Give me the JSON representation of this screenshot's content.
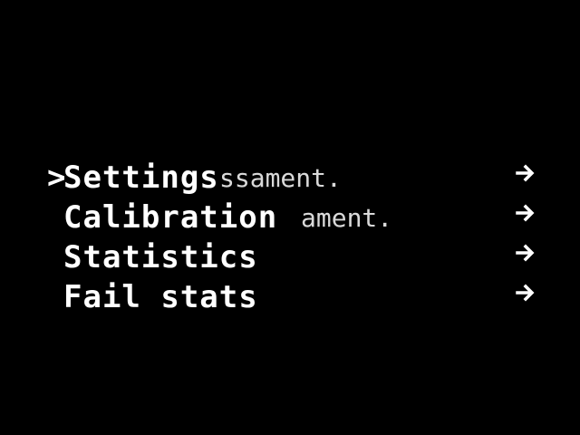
{
  "menu": {
    "cursor": ">",
    "items": [
      {
        "label": "Settings",
        "ghost": "ssament."
      },
      {
        "label": "Calibration",
        "ghost": "ament."
      },
      {
        "label": "Statistics",
        "ghost": ""
      },
      {
        "label": "Fail stats",
        "ghost": ""
      }
    ],
    "arrow_icon": "arrow-right-icon"
  },
  "colors": {
    "background": "#000000",
    "foreground": "#ffffff"
  }
}
